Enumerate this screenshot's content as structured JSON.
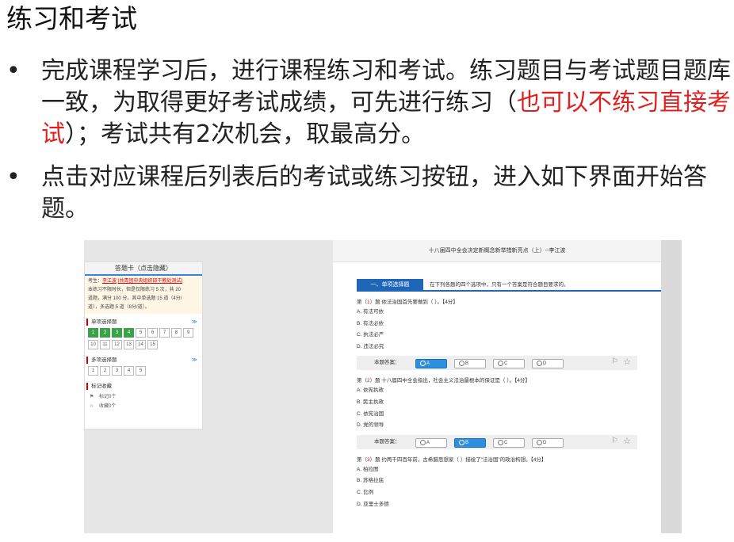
{
  "slide": {
    "title": "练习和考试",
    "bullet_symbol": "•",
    "bullet1": {
      "part1": "完成课程学习后，进行课程练习和考试。练习题目与考试题目题库一致，为取得更好考试成绩，可先进行练习（",
      "red": "也可以不练习直接考试",
      "part2": "）；考试共有2次机会，取最高分。"
    },
    "bullet2": "点击对应课程后列表后的考试或练习按钮，进入如下界面开始答题。"
  },
  "answer_card": {
    "header": "答题卡（点击隐藏）",
    "examinee_label": "考生：",
    "examinee_name": "李江波",
    "examinee_org": "[共青团中央组织部干教处测试]",
    "info_line1": "本练习不限时长，但是仅限练习 5 次，共 20",
    "info_line2": "道题，满分 100 分。其中单选题 15 道（4分/",
    "info_line3": "道），多选题 5 道（8分/道）。",
    "single_label": "单项选择题",
    "single_nums": [
      "1",
      "2",
      "3",
      "4",
      "5",
      "6",
      "7",
      "8",
      "9",
      "10",
      "11",
      "12",
      "13",
      "14",
      "15"
    ],
    "single_done": 4,
    "multi_label": "多项选择题",
    "multi_nums": [
      "1",
      "2",
      "3",
      "4",
      "5"
    ],
    "mark_label": "标记收藏",
    "flag_label": "标记0个",
    "fav_label": "收藏0个",
    "chevron": "≫"
  },
  "paper": {
    "title": "十八届四中全会决定新概念新举措新亮点（上）--李江波",
    "section_tab": "一、单项选择题",
    "section_desc": "在下列各题的四个选项中，只有一个答案是符合题目要求的。",
    "answer_label": "本题答案：",
    "options": [
      "A",
      "B",
      "C",
      "D"
    ],
    "questions": [
      {
        "prefix": "第（",
        "num": "1",
        "suffix": "）题 依法治国首先要做到（ ）。【4分】",
        "choices": [
          "A. 有法可依",
          "B. 有法必依",
          "C. 执法必严",
          "D. 违法必究"
        ],
        "selected": "A"
      },
      {
        "prefix": "第（",
        "num": "2",
        "suffix": "）题 十八届四中全会指出，社会主义法治最根本的保证是（ ）。【4分】",
        "choices": [
          "A. 依宪执政",
          "B. 民主执政",
          "C. 依宪治国",
          "D. 党的领导"
        ],
        "selected": "B"
      },
      {
        "prefix": "第（",
        "num": "3",
        "suffix": "）题 约两千四百年前，古希腊思想家（ ）描绘了“法治国”的政治构想。【4分】",
        "choices": [
          "A. 柏拉图",
          "B. 苏格拉底",
          "C. 比例",
          "D. 亚里士多德"
        ],
        "selected": ""
      }
    ]
  }
}
